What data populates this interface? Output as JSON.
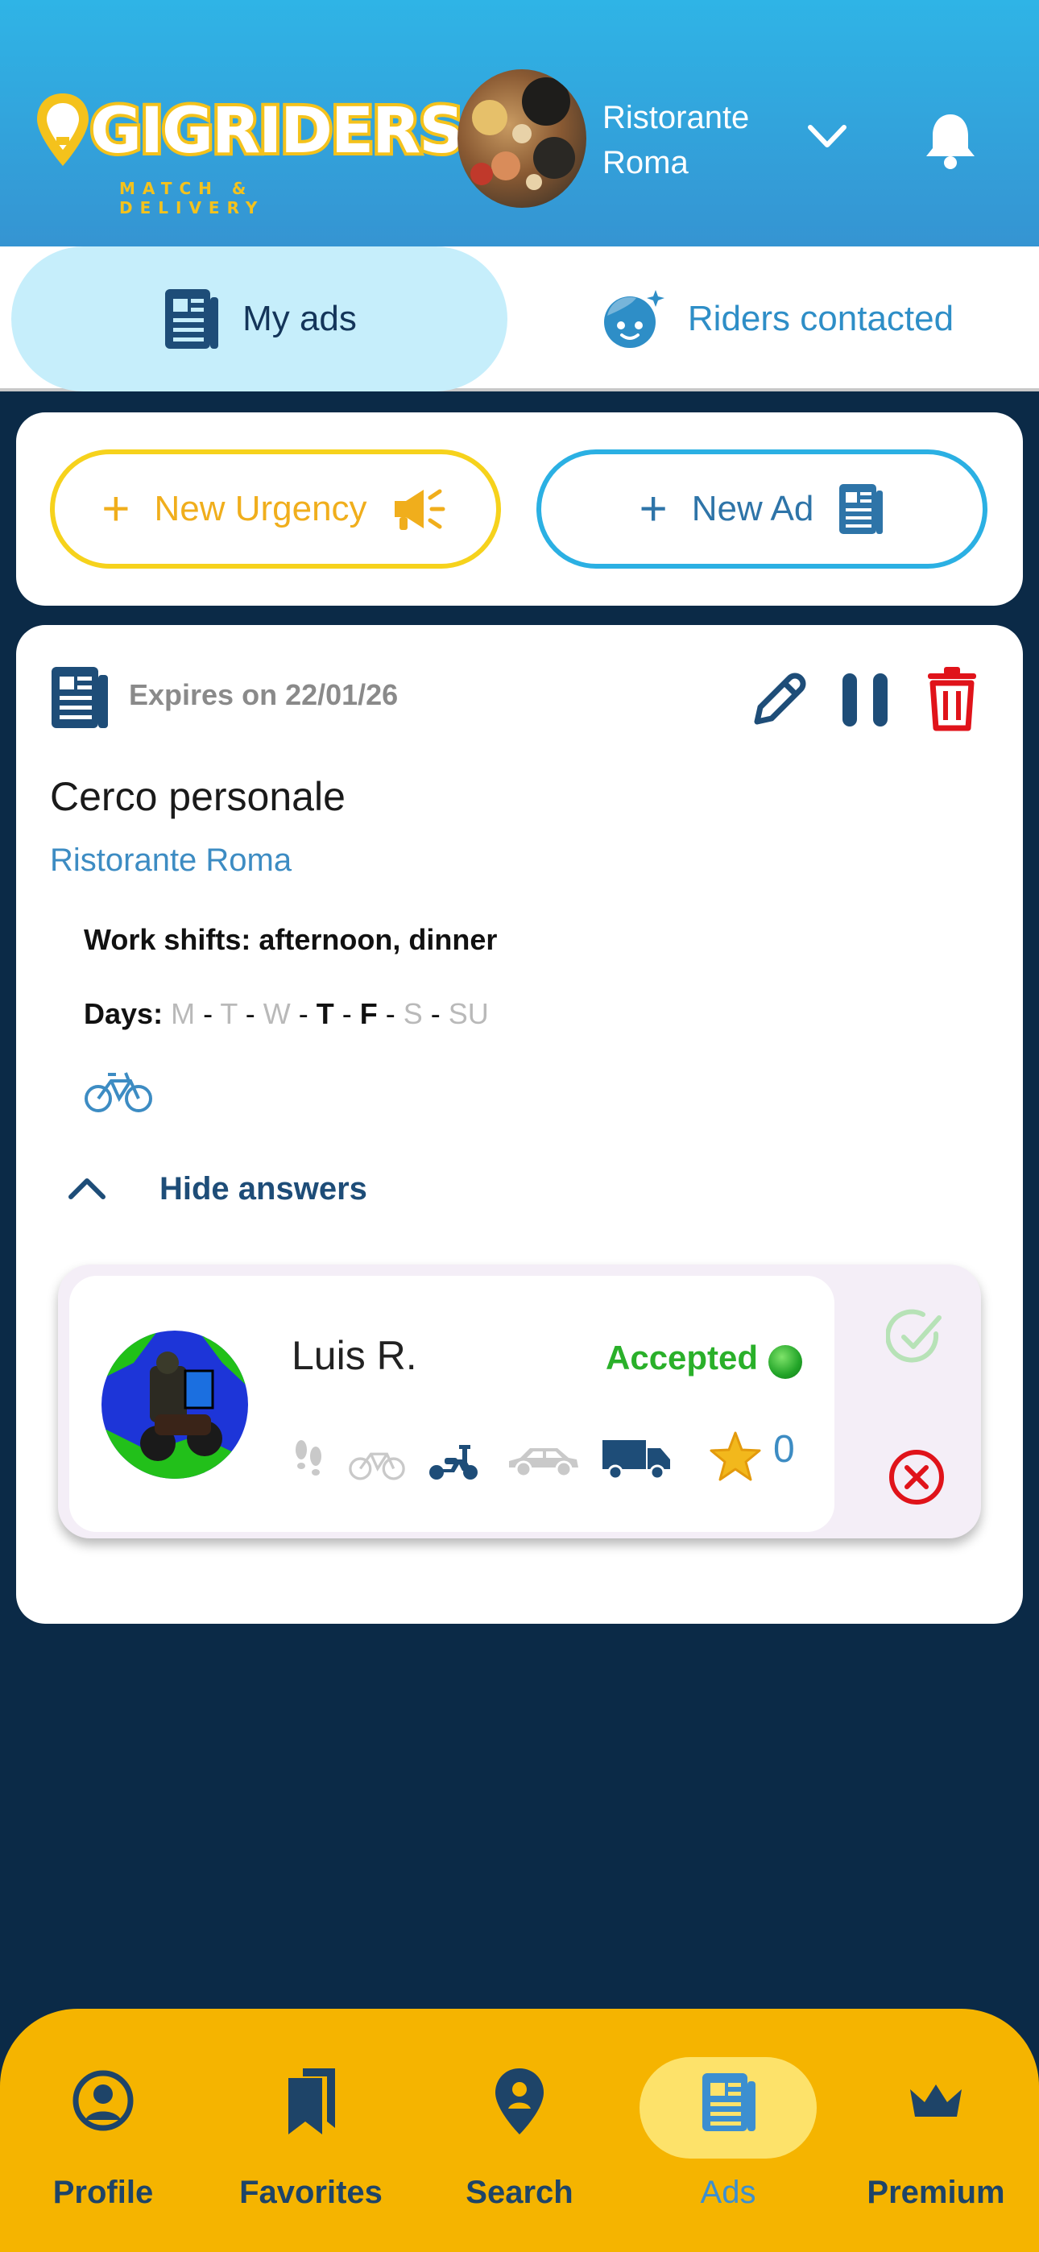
{
  "header": {
    "logo_text": "GIGRIDERS",
    "logo_tagline": "MATCH & DELIVERY",
    "restaurant_name": "Ristorante Roma"
  },
  "tabs": [
    {
      "label": "My ads",
      "icon": "document-icon",
      "active": true
    },
    {
      "label": "Riders contacted",
      "icon": "rider-face-icon",
      "active": false
    }
  ],
  "actions": {
    "new_urgency_label": "New Urgency",
    "new_ad_label": "New Ad"
  },
  "ad": {
    "expires": "Expires on 22/01/26",
    "title": "Cerco personale",
    "company": "Ristorante Roma",
    "shifts": "Work shifts: afternoon, dinner",
    "days_label": "Days:",
    "days": [
      {
        "label": "M",
        "active": false
      },
      {
        "label": "T",
        "active": false
      },
      {
        "label": "W",
        "active": false
      },
      {
        "label": "T",
        "active": true
      },
      {
        "label": "F",
        "active": true
      },
      {
        "label": "S",
        "active": false
      },
      {
        "label": "SU",
        "active": false
      }
    ],
    "vehicle": "bicycle-icon",
    "toggle_answers_label": "Hide answers"
  },
  "answer": {
    "rider_name": "Luis R.",
    "status": "Accepted",
    "rating": "0",
    "modes": [
      {
        "name": "walk-icon",
        "active": false
      },
      {
        "name": "bicycle-icon",
        "active": false
      },
      {
        "name": "scooter-icon",
        "active": true
      },
      {
        "name": "car-icon",
        "active": false
      },
      {
        "name": "van-icon",
        "active": true
      }
    ]
  },
  "colors": {
    "accent_yellow": "#f5b400",
    "brand_blue": "#2fb4e6",
    "navy": "#0b2a47",
    "accepted_green": "#2ab02a",
    "delete_red": "#e0131a"
  },
  "bottom_nav": [
    {
      "label": "Profile",
      "icon": "user-circle-icon"
    },
    {
      "label": "Favorites",
      "icon": "bookmarks-icon"
    },
    {
      "label": "Search",
      "icon": "map-pin-icon"
    },
    {
      "label": "Ads",
      "icon": "document-icon",
      "active": true
    },
    {
      "label": "Premium",
      "icon": "crown-icon"
    }
  ]
}
